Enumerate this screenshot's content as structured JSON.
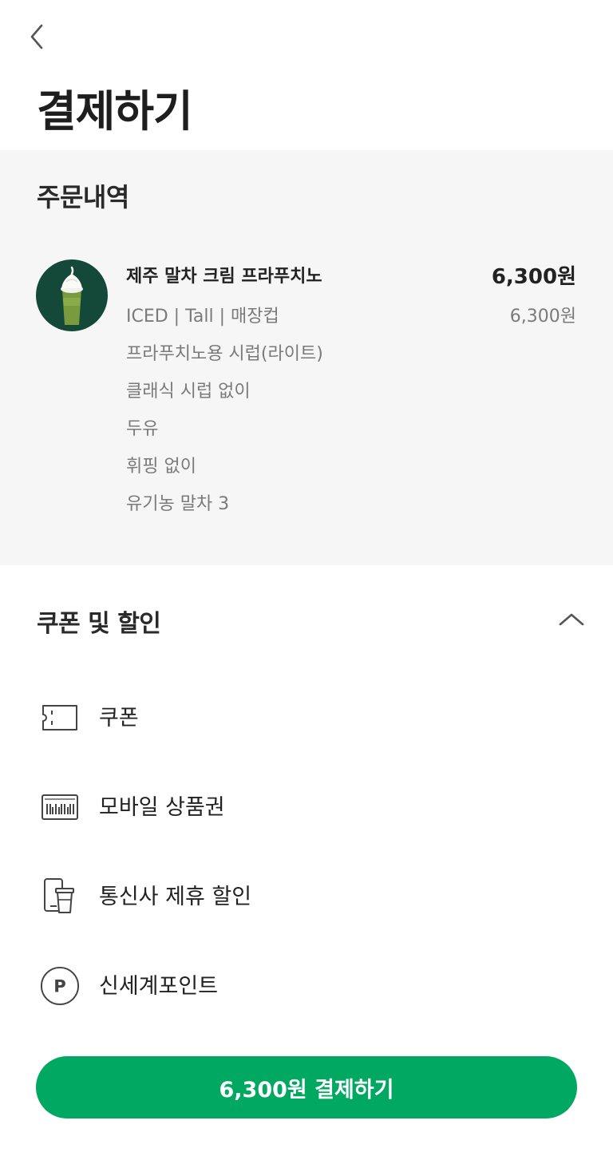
{
  "header": {
    "title": "결제하기"
  },
  "order": {
    "section_title": "주문내역",
    "item": {
      "name": "제주 말차 크림 프라푸치노",
      "price": "6,300원",
      "options_price": "6,300원",
      "options": [
        "ICED | Tall | 매장컵",
        "프라푸치노용 시럽(라이트)",
        "클래식 시럽 없이",
        "두유",
        "휘핑 없이",
        "유기농 말차 3"
      ]
    }
  },
  "discounts": {
    "title": "쿠폰 및 할인",
    "items": [
      {
        "label": "쿠폰",
        "icon": "coupon-icon"
      },
      {
        "label": "모바일 상품권",
        "icon": "gift-card-icon"
      },
      {
        "label": "통신사 제휴 할인",
        "icon": "phone-cup-icon"
      },
      {
        "label": "신세계포인트",
        "icon": "point-icon"
      }
    ]
  },
  "footer": {
    "pay_label": "6,300원 결제하기"
  },
  "colors": {
    "accent": "#00a862",
    "thumb_bg": "#14493a",
    "section_bg": "#f6f6f6"
  }
}
